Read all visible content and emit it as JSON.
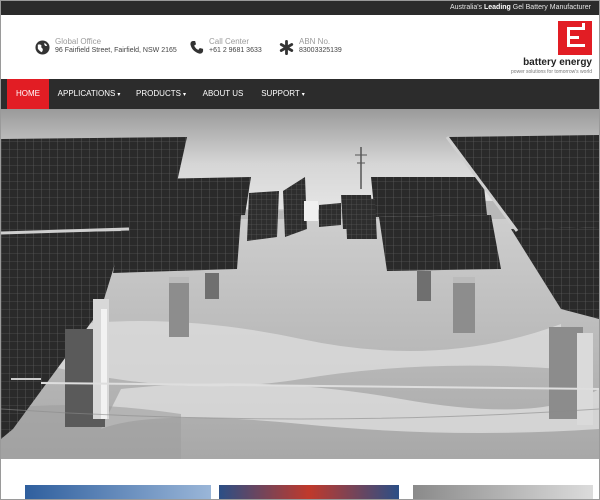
{
  "top_strip": {
    "prefix": "Australia's ",
    "highlight": "Leading",
    "suffix": " Gel Battery Manufacturer"
  },
  "header": {
    "office": {
      "icon": "globe-icon",
      "label": "Global Office",
      "value": "96 Fairfield Street, Fairfield, NSW 2165"
    },
    "call": {
      "icon": "phone-icon",
      "label": "Call Center",
      "value": "+61 2 9681 3633"
    },
    "abn": {
      "icon": "asterisk-icon",
      "label": "ABN No.",
      "value": "83003325139"
    }
  },
  "logo": {
    "name": "battery energy",
    "tagline": "power solutions for tomorrow's world",
    "color": "#e21d24"
  },
  "nav": {
    "items": [
      {
        "label": "HOME",
        "active": true
      },
      {
        "label": "APPLICATIONS",
        "has_dropdown": true
      },
      {
        "label": "PRODUCTS",
        "has_dropdown": true
      },
      {
        "label": "ABOUT US"
      },
      {
        "label": "SUPPORT",
        "has_dropdown": true
      }
    ],
    "caret": "▾"
  },
  "hero": {
    "description": "solar-panel-field-photo"
  },
  "colors": {
    "accent": "#e21d24",
    "nav_bg": "#2c2c2c",
    "top_strip_bg": "#2b2b2b"
  }
}
